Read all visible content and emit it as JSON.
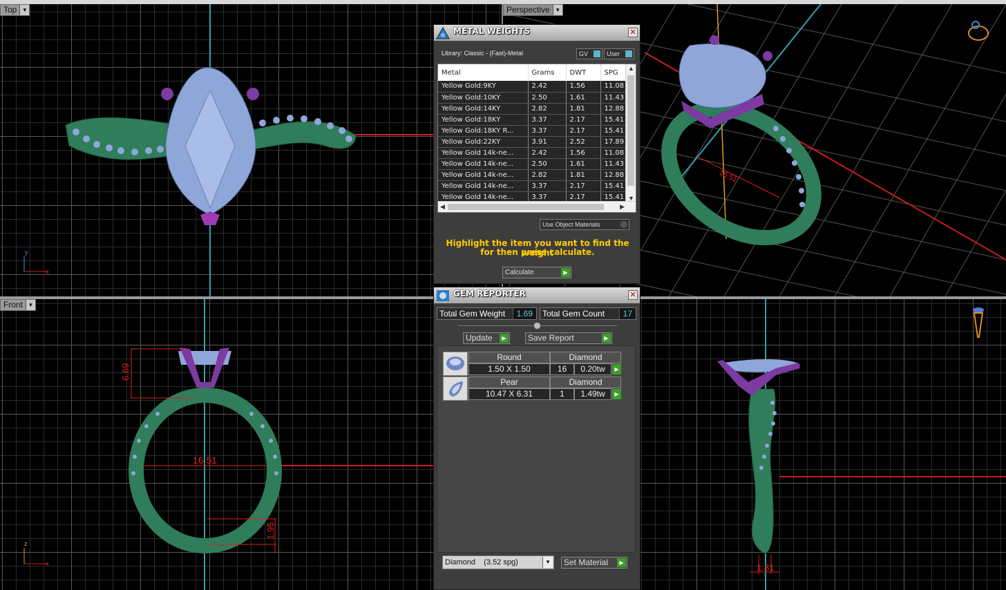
{
  "viewports": {
    "top": {
      "label": "Top"
    },
    "perspective": {
      "label": "Perspective"
    },
    "front": {
      "label": "Front"
    }
  },
  "dimensions": {
    "height": "6.69",
    "inner_diameter": "16.51",
    "band_top": "1.95",
    "side_width": "1.81"
  },
  "metal_weights": {
    "title": "METAL WEIGHTS",
    "library": "Library: Classic - (Fast)-Metal",
    "gv_label": "GV",
    "user_label": "User",
    "columns": [
      "Metal",
      "Grams",
      "DWT",
      "SPG"
    ],
    "rows": [
      [
        "Yellow Gold:9KY",
        "2.42",
        "1.56",
        "11.08"
      ],
      [
        "Yellow Gold:10KY",
        "2.50",
        "1.61",
        "11.43"
      ],
      [
        "Yellow Gold:14KY",
        "2.82",
        "1.81",
        "12.88"
      ],
      [
        "Yellow Gold:18KY",
        "3.37",
        "2.17",
        "15.41"
      ],
      [
        "Yellow Gold:18KY R...",
        "3.37",
        "2.17",
        "15.41"
      ],
      [
        "Yellow Gold:22KY",
        "3.91",
        "2.52",
        "17.89"
      ],
      [
        "Yellow Gold 14k-ne...",
        "2.42",
        "1.56",
        "11.08"
      ],
      [
        "Yellow Gold 14k-ne...",
        "2.50",
        "1.61",
        "11.43"
      ],
      [
        "Yellow Gold 14k-ne...",
        "2.82",
        "1.81",
        "12.88"
      ],
      [
        "Yellow Gold 14k-ne...",
        "3.37",
        "2.17",
        "15.41"
      ],
      [
        "Yellow Gold 14k-ne...",
        "3.37",
        "2.17",
        "15.41"
      ]
    ],
    "use_object_materials": "Use Object Materials",
    "hint_line1": "Highlight the item you want to find the weight",
    "hint_line2": "for then press calculate.",
    "calculate": "Calculate"
  },
  "gem_reporter": {
    "title": "GEM REPORTER",
    "total_weight_label": "Total Gem Weight",
    "total_weight_value": "1.69",
    "total_count_label": "Total Gem Count",
    "total_count_value": "17",
    "update": "Update",
    "save_report": "Save Report",
    "gems": [
      {
        "shape": "Round",
        "size": "1.50 X 1.50",
        "material": "Diamond",
        "count": "16",
        "weight": "0.20tw"
      },
      {
        "shape": "Pear",
        "size": "10.47 X 6.31",
        "material": "Diamond",
        "count": "1",
        "weight": "1.49tw"
      }
    ],
    "material_select": "Diamond    (3.52 spg)",
    "set_material": "Set Material"
  },
  "colors": {
    "band": "#2f7d5a",
    "stone": "#8fa7d8",
    "prongs": "#7d3aa0",
    "dims": "#e0201d",
    "axis_y": "#2fa3b3"
  }
}
